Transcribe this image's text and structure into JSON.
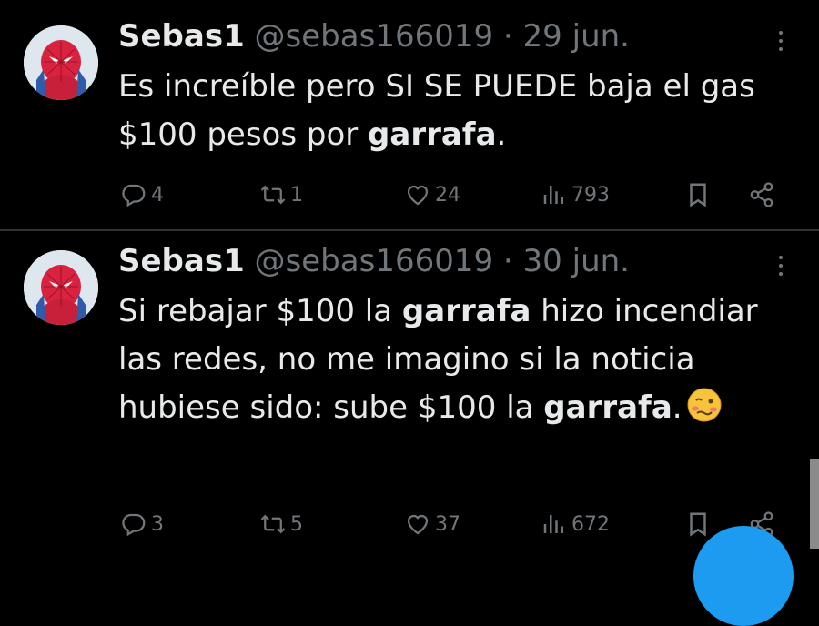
{
  "tweets": [
    {
      "name": "Sebas1",
      "handle": "@sebas166019",
      "separator": "·",
      "date": "29 jun.",
      "text_parts": [
        {
          "t": "Es increíble pero SI SE PUEDE baja el gas $100 pesos por ",
          "b": false
        },
        {
          "t": "garrafa",
          "b": true
        },
        {
          "t": ".",
          "b": false
        }
      ],
      "replies": "4",
      "retweets": "1",
      "likes": "24",
      "views": "793"
    },
    {
      "name": "Sebas1",
      "handle": "@sebas166019",
      "separator": "·",
      "date": "30 jun.",
      "text_parts": [
        {
          "t": "Si rebajar $100 la ",
          "b": false
        },
        {
          "t": "garrafa",
          "b": true
        },
        {
          "t": " hizo incendiar las redes, no me imagino si la noticia hubiese sido: sube $100 la ",
          "b": false
        },
        {
          "t": "garrafa",
          "b": true
        },
        {
          "t": ".",
          "b": false
        }
      ],
      "emoji": "woozy-face",
      "replies": "3",
      "retweets": "5",
      "likes": "37",
      "views": "672"
    }
  ],
  "colors": {
    "background": "#000000",
    "text": "#e7e9ea",
    "secondary": "#71767b",
    "accent": "#1d9bf0"
  }
}
